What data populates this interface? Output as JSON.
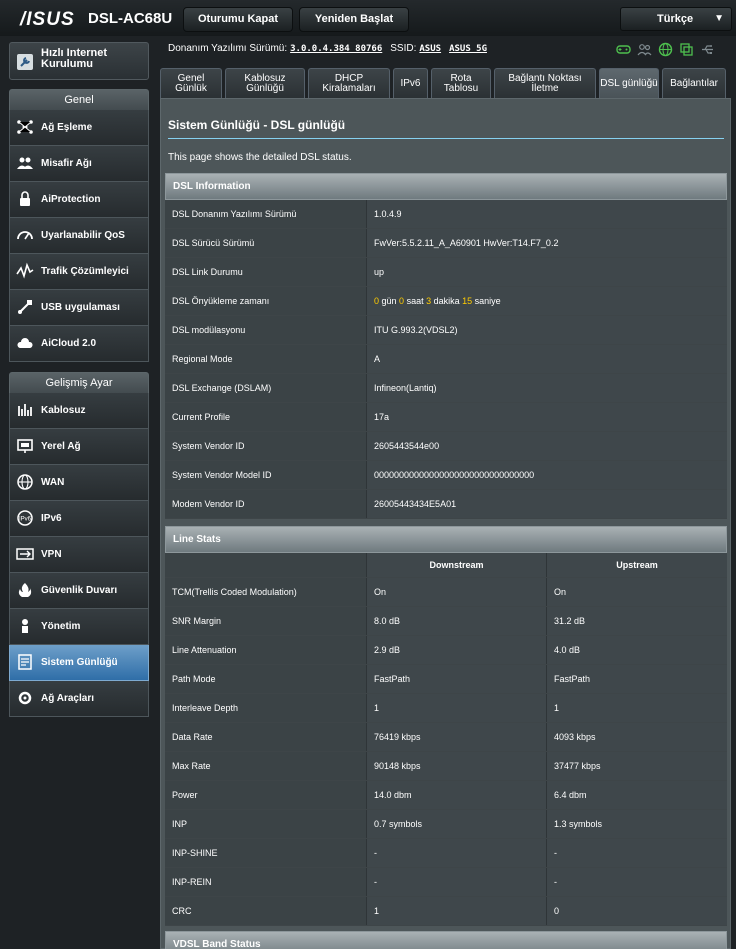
{
  "header": {
    "logo": "/ISUS",
    "model": "DSL-AC68U",
    "logout_label": "Oturumu Kapat",
    "reboot_label": "Yeniden Başlat",
    "language": "Türkçe"
  },
  "firmware": {
    "label": "Donanım Yazılımı Sürümü:",
    "version": "3.0.0.4.384_80766",
    "ssid_label": "SSID:",
    "ssid1": "ASUS",
    "ssid2": "ASUS_5G"
  },
  "sidebar": {
    "quick_setup": "Hızlı Internet Kurulumu",
    "general_title": "Genel",
    "general_items": [
      {
        "label": "Ağ Eşleme",
        "icon": "network-map-icon"
      },
      {
        "label": "Misafir Ağı",
        "icon": "guest-network-icon"
      },
      {
        "label": "AiProtection",
        "icon": "aiprotection-lock-icon"
      },
      {
        "label": "Uyarlanabilir QoS",
        "icon": "qos-gauge-icon"
      },
      {
        "label": "Trafik Çözümleyici",
        "icon": "traffic-analyzer-icon"
      },
      {
        "label": "USB uygulaması",
        "icon": "usb-application-icon"
      },
      {
        "label": "AiCloud 2.0",
        "icon": "aicloud-icon"
      }
    ],
    "advanced_title": "Gelişmiş Ayar",
    "advanced_items": [
      {
        "label": "Kablosuz",
        "icon": "wireless-icon"
      },
      {
        "label": "Yerel Ağ",
        "icon": "lan-icon"
      },
      {
        "label": "WAN",
        "icon": "wan-globe-icon"
      },
      {
        "label": "IPv6",
        "icon": "ipv6-icon"
      },
      {
        "label": "VPN",
        "icon": "vpn-icon"
      },
      {
        "label": "Güvenlik Duvarı",
        "icon": "firewall-icon"
      },
      {
        "label": "Yönetim",
        "icon": "administration-icon"
      },
      {
        "label": "Sistem Günlüğü",
        "icon": "system-log-icon"
      },
      {
        "label": "Ağ Araçları",
        "icon": "network-tools-icon"
      }
    ]
  },
  "tabs": [
    "Genel Günlük",
    "Kablosuz Günlüğü",
    "DHCP Kiralamaları",
    "IPv6",
    "Rota Tablosu",
    "Bağlantı Noktası İletme",
    "DSL günlüğü",
    "Bağlantılar"
  ],
  "main": {
    "title": "Sistem Günlüğü - DSL günlüğü",
    "description": "This page shows the detailed DSL status."
  },
  "dsl_info": {
    "title": "DSL Information",
    "rows": [
      {
        "key": "DSL Donanım Yazılımı Sürümü",
        "value": "1.0.4.9"
      },
      {
        "key": "DSL Sürücü Sürümü",
        "value": "FwVer:5.5.2.11_A_A60901 HwVer:T14.F7_0.2"
      },
      {
        "key": "DSL Link Durumu",
        "value": "up"
      },
      {
        "key": "DSL Önyükleme zamanı",
        "value": ""
      },
      {
        "key": "DSL modülasyonu",
        "value": "ITU G.993.2(VDSL2)"
      },
      {
        "key": "Regional Mode",
        "value": "A"
      },
      {
        "key": "DSL Exchange (DSLAM)",
        "value": "Infineon(Lantiq)"
      },
      {
        "key": "Current Profile",
        "value": "17a"
      },
      {
        "key": "System Vendor ID",
        "value": "2605443544e00"
      },
      {
        "key": "System Vendor Model ID",
        "value": "00000000000000000000000000000000"
      },
      {
        "key": "Modem Vendor ID",
        "value": "26005443434E5A01"
      }
    ],
    "uptime": {
      "days": "0",
      "days_label": "gün",
      "hours": "0",
      "hours_label": "saat",
      "minutes": "3",
      "minutes_label": "dakika",
      "seconds": "15",
      "seconds_label": "saniye"
    }
  },
  "line_stats": {
    "title": "Line Stats",
    "downstream_label": "Downstream",
    "upstream_label": "Upstream",
    "rows": [
      {
        "key": "TCM(Trellis Coded Modulation)",
        "down": "On",
        "up": "On"
      },
      {
        "key": "SNR Margin",
        "down": "8.0 dB",
        "up": "31.2 dB"
      },
      {
        "key": "Line Attenuation",
        "down": "2.9 dB",
        "up": "4.0 dB"
      },
      {
        "key": "Path Mode",
        "down": "FastPath",
        "up": "FastPath"
      },
      {
        "key": "Interleave Depth",
        "down": "1",
        "up": "1"
      },
      {
        "key": "Data Rate",
        "down": "76419 kbps",
        "up": "4093 kbps"
      },
      {
        "key": "Max Rate",
        "down": "90148 kbps",
        "up": "37477 kbps"
      },
      {
        "key": "Power",
        "down": "14.0 dbm",
        "up": "6.4 dbm"
      },
      {
        "key": "INP",
        "down": "0.7 symbols",
        "up": "1.3 symbols"
      },
      {
        "key": "INP-SHINE",
        "down": "-",
        "up": "-"
      },
      {
        "key": "INP-REIN",
        "down": "-",
        "up": "-"
      },
      {
        "key": "CRC",
        "down": "1",
        "up": "0"
      }
    ]
  },
  "vdsl_band": {
    "title": "VDSL Band Status"
  },
  "colors": {
    "accent_blue": "#86d1f0",
    "active_menu": "#3f7db5",
    "uptime_highlight": "#ffcc00",
    "status_green": "#4ec04e"
  }
}
